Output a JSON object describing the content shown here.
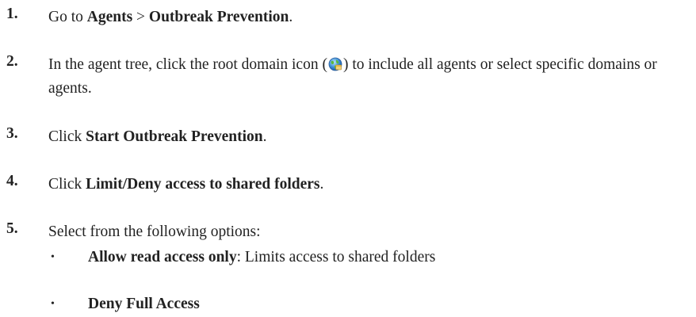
{
  "steps": [
    {
      "number": "1.",
      "pre": "Go to ",
      "b1": "Agents",
      "mid": " > ",
      "b2": "Outbreak Prevention",
      "post": "."
    },
    {
      "number": "2.",
      "pre": "In the agent tree, click the root domain icon (",
      "icon": "root-domain-globe-icon",
      "post": ") to include all agents or select specific domains or agents."
    },
    {
      "number": "3.",
      "pre": "Click ",
      "b1": "Start Outbreak Prevention",
      "post": "."
    },
    {
      "number": "4.",
      "pre": "Click ",
      "b1": "Limit/Deny access to shared folders",
      "post": "."
    },
    {
      "number": "5.",
      "text": "Select from the following options:"
    }
  ],
  "options": [
    {
      "bullet": "•",
      "bold": "Allow read access only",
      "rest": ": Limits access to shared folders"
    },
    {
      "bullet": "•",
      "bold": "Deny Full Access",
      "rest": ""
    }
  ]
}
